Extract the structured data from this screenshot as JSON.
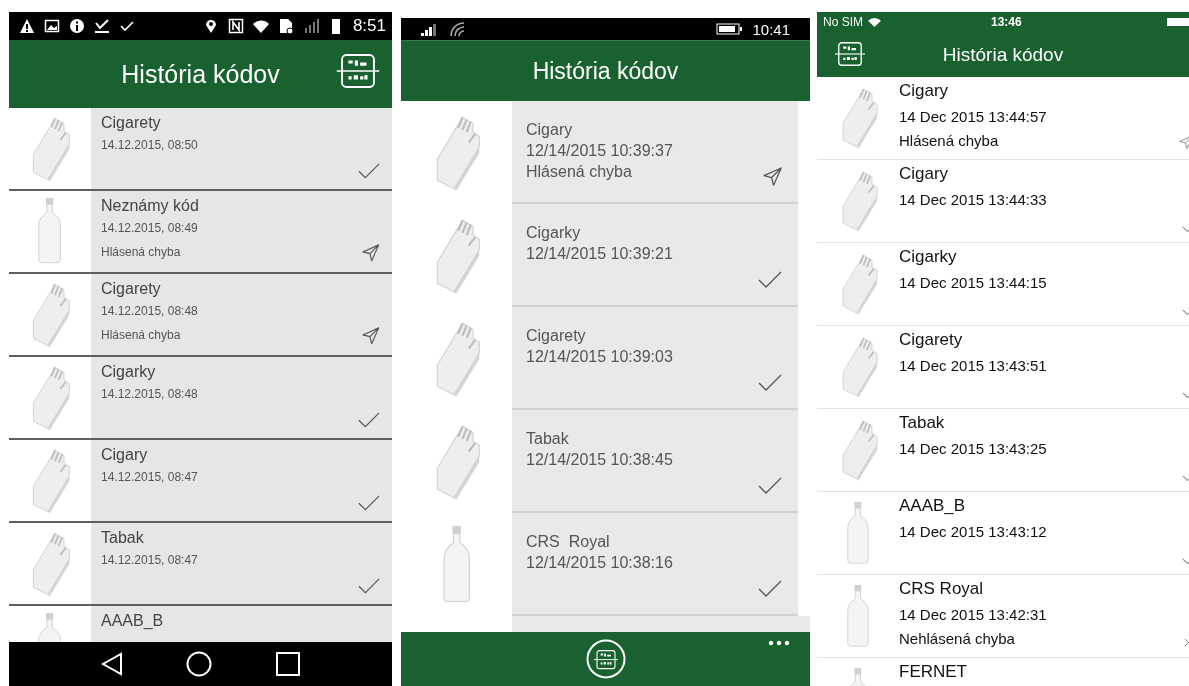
{
  "android": {
    "status_bar": {
      "time": "8:51"
    },
    "header": {
      "title": "História kódov"
    },
    "rows": [
      {
        "title": "Cigarety",
        "date": "14.12.2015, 08:50",
        "kind": "pack",
        "reported": false
      },
      {
        "title": "Neznámy kód",
        "date": "14.12.2015, 08:49",
        "status": "Hlásená chyba",
        "kind": "bottle",
        "reported": true
      },
      {
        "title": "Cigarety",
        "date": "14.12.2015, 08:48",
        "status": "Hlásená chyba",
        "kind": "pack",
        "reported": true
      },
      {
        "title": "Cigarky",
        "date": "14.12.2015, 08:48",
        "kind": "pack",
        "reported": false
      },
      {
        "title": "Cigary",
        "date": "14.12.2015, 08:47",
        "kind": "pack",
        "reported": false
      },
      {
        "title": "Tabak",
        "date": "14.12.2015, 08:47",
        "kind": "pack",
        "reported": false
      },
      {
        "title": "AAAB_B",
        "kind": "bottle"
      }
    ]
  },
  "windows_phone": {
    "status_bar": {
      "time": "10:41"
    },
    "header": {
      "title": "História kódov"
    },
    "rows": [
      {
        "title": "Cigary",
        "date": "12/14/2015 10:39:37",
        "status": "Hlásená chyba",
        "kind": "pack",
        "reported": true
      },
      {
        "title": "Cigarky",
        "date": "12/14/2015 10:39:21",
        "kind": "pack",
        "reported": false
      },
      {
        "title": "Cigarety",
        "date": "12/14/2015 10:39:03",
        "kind": "pack",
        "reported": false
      },
      {
        "title": "Tabak",
        "date": "12/14/2015 10:38:45",
        "kind": "pack",
        "reported": false
      },
      {
        "title": "CRS  Royal",
        "date": "12/14/2015 10:38:16",
        "kind": "bottle",
        "reported": false
      }
    ]
  },
  "ios": {
    "status_bar": {
      "carrier": "No SIM",
      "time": "13:46"
    },
    "header": {
      "title": "História kódov"
    },
    "rows": [
      {
        "title": "Cigary",
        "date": "14 Dec 2015 13:44:57",
        "status": "Hlásená chyba",
        "kind": "pack",
        "reported": true,
        "unreported_error": false
      },
      {
        "title": "Cigary",
        "date": "14 Dec 2015 13:44:33",
        "kind": "pack",
        "reported": false,
        "unreported_error": false
      },
      {
        "title": "Cigarky",
        "date": "14 Dec 2015 13:44:15",
        "kind": "pack",
        "reported": false,
        "unreported_error": false
      },
      {
        "title": "Cigarety",
        "date": "14 Dec 2015 13:43:51",
        "kind": "pack",
        "reported": false,
        "unreported_error": false
      },
      {
        "title": "Tabak",
        "date": "14 Dec 2015 13:43:25",
        "kind": "pack",
        "reported": false,
        "unreported_error": false
      },
      {
        "title": "AAAB_B",
        "date": "14 Dec 2015 13:43:12",
        "kind": "bottle",
        "reported": false,
        "unreported_error": false
      },
      {
        "title": "CRS Royal",
        "date": "14 Dec 2015 13:42:31",
        "status": "Nehlásená chyba",
        "kind": "bottle",
        "reported": false,
        "unreported_error": true
      },
      {
        "title": "FERNET",
        "kind": "bottle"
      }
    ]
  }
}
